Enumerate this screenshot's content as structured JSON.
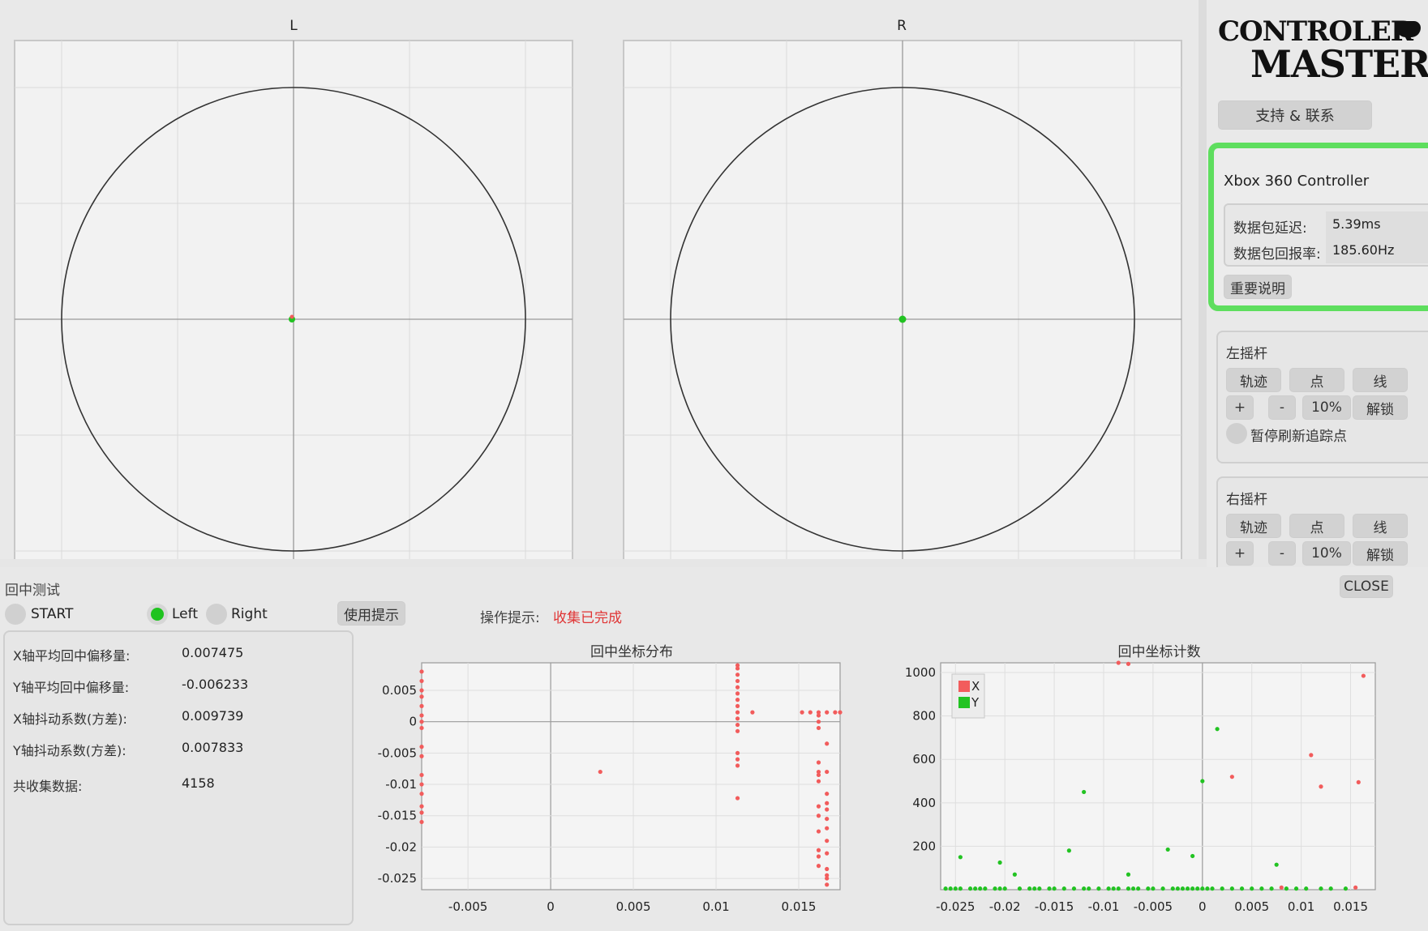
{
  "plots": {
    "left_title": "L",
    "right_title": "R"
  },
  "sidebar": {
    "logo_line1": "CONTROLER",
    "logo_line2": "MASTER",
    "support_label": "支持 & 联系",
    "device_name": "Xbox 360 Controller",
    "latency_label": "数据包延迟:",
    "latency_value": "5.39ms",
    "rate_label": "数据包回报率:",
    "rate_value": "185.60Hz",
    "note_label": "重要说明",
    "left_stick": {
      "title": "左摇杆",
      "trace": "轨迹",
      "point": "点",
      "line": "线",
      "plus": "+",
      "minus": "-",
      "percent": "10%",
      "unlock": "解锁",
      "pause": "暂停刷新追踪点"
    },
    "right_stick": {
      "title": "右摇杆",
      "trace": "轨迹",
      "point": "点",
      "line": "线",
      "plus": "+",
      "minus": "-",
      "percent": "10%",
      "unlock": "解锁"
    }
  },
  "centering": {
    "title": "回中测试",
    "close": "CLOSE",
    "start": "START",
    "left": "Left",
    "right": "Right",
    "selected": "Left",
    "hint_button": "使用提示",
    "op_label": "操作提示:",
    "op_status": "收集已完成",
    "results": [
      {
        "label": "X轴平均回中偏移量:",
        "value": "0.007475"
      },
      {
        "label": "Y轴平均回中偏移量:",
        "value": "-0.006233"
      },
      {
        "label": "X轴抖动系数(方差):",
        "value": "0.009739"
      },
      {
        "label": "Y轴抖动系数(方差):",
        "value": "0.007833"
      },
      {
        "label": "共收集数据:",
        "value": "4158"
      }
    ]
  },
  "colors": {
    "accent_green": "#5ede5e",
    "series_x": "#f25c5c",
    "series_y": "#22c322",
    "status_red": "#e03434"
  },
  "chart_data": [
    {
      "type": "scatter",
      "title": "回中坐标分布",
      "xlim": [
        -0.0078,
        0.0175
      ],
      "ylim": [
        -0.0268,
        0.0094
      ],
      "x_ticks": [
        -0.005,
        0,
        0.005,
        0.01,
        0.015
      ],
      "x_tick_labels": [
        "-0.005",
        "0",
        "0.005",
        "0.01",
        "0.015"
      ],
      "y_ticks": [
        0.005,
        0,
        -0.005,
        -0.01,
        -0.015,
        -0.02,
        -0.025
      ],
      "y_tick_labels": [
        "0.005",
        "0",
        "-0.005",
        "-0.01",
        "-0.015",
        "-0.02",
        "-0.025"
      ],
      "series": [
        {
          "points": [
            [
              -0.0078,
              0.008
            ],
            [
              -0.0078,
              0.0065
            ],
            [
              -0.0078,
              0.005
            ],
            [
              -0.0078,
              0.004
            ],
            [
              -0.0078,
              0.0025
            ],
            [
              -0.0078,
              0.001
            ],
            [
              -0.0078,
              0.0
            ],
            [
              -0.0078,
              -0.001
            ],
            [
              -0.0078,
              -0.004
            ],
            [
              -0.0078,
              -0.0055
            ],
            [
              -0.0078,
              -0.0085
            ],
            [
              -0.0078,
              -0.01
            ],
            [
              -0.0078,
              -0.0115
            ],
            [
              -0.0078,
              -0.0135
            ],
            [
              -0.0078,
              -0.0145
            ],
            [
              -0.0078,
              -0.016
            ],
            [
              0.003,
              -0.008
            ],
            [
              0.0113,
              0.009
            ],
            [
              0.0113,
              0.0085
            ],
            [
              0.0113,
              0.0075
            ],
            [
              0.0113,
              0.0065
            ],
            [
              0.0113,
              0.0055
            ],
            [
              0.0113,
              0.0045
            ],
            [
              0.0113,
              0.0035
            ],
            [
              0.0113,
              0.0025
            ],
            [
              0.0113,
              0.0015
            ],
            [
              0.0113,
              0.0005
            ],
            [
              0.0113,
              -0.0005
            ],
            [
              0.0113,
              -0.0015
            ],
            [
              0.0113,
              -0.005
            ],
            [
              0.0113,
              -0.006
            ],
            [
              0.0113,
              -0.007
            ],
            [
              0.0113,
              -0.0122
            ],
            [
              0.0122,
              0.0015
            ],
            [
              0.0152,
              0.0015
            ],
            [
              0.0157,
              0.0015
            ],
            [
              0.0162,
              0.0015
            ],
            [
              0.0167,
              0.0015
            ],
            [
              0.0172,
              0.0015
            ],
            [
              0.0175,
              0.0015
            ],
            [
              0.0162,
              0.001
            ],
            [
              0.0162,
              0.0
            ],
            [
              0.0162,
              -0.001
            ],
            [
              0.0162,
              -0.0065
            ],
            [
              0.0162,
              -0.008
            ],
            [
              0.0162,
              -0.0085
            ],
            [
              0.0162,
              -0.0095
            ],
            [
              0.0162,
              -0.0135
            ],
            [
              0.0162,
              -0.015
            ],
            [
              0.0162,
              -0.0175
            ],
            [
              0.0162,
              -0.0205
            ],
            [
              0.0162,
              -0.0215
            ],
            [
              0.0162,
              -0.023
            ],
            [
              0.0167,
              -0.008
            ],
            [
              0.0167,
              -0.0115
            ],
            [
              0.0167,
              -0.013
            ],
            [
              0.0167,
              -0.014
            ],
            [
              0.0167,
              -0.0155
            ],
            [
              0.0167,
              -0.017
            ],
            [
              0.0167,
              -0.019
            ],
            [
              0.0167,
              -0.021
            ],
            [
              0.0167,
              -0.0235
            ],
            [
              0.0167,
              -0.0245
            ],
            [
              0.0167,
              -0.025
            ],
            [
              0.0167,
              -0.026
            ],
            [
              0.0167,
              -0.0035
            ]
          ]
        }
      ]
    },
    {
      "type": "scatter",
      "title": "回中坐标计数",
      "xlim": [
        -0.0265,
        0.0175
      ],
      "ylim": [
        0,
        1045
      ],
      "x_ticks": [
        -0.025,
        -0.02,
        -0.015,
        -0.01,
        -0.005,
        0,
        0.005,
        0.01,
        0.015
      ],
      "x_tick_labels": [
        "-0.025",
        "-0.02",
        "-0.015",
        "-0.01",
        "-0.005",
        "0",
        "0.005",
        "0.01",
        "0.015"
      ],
      "y_ticks": [
        200,
        400,
        600,
        800,
        1000
      ],
      "y_tick_labels": [
        "200",
        "400",
        "600",
        "800",
        "1000"
      ],
      "legend": [
        "X",
        "Y"
      ],
      "legend_position": "top-left",
      "series": [
        {
          "name": "X",
          "points": [
            [
              -0.0075,
              1040
            ],
            [
              0.003,
              520
            ],
            [
              0.011,
              620
            ],
            [
              0.012,
              475
            ],
            [
              0.0158,
              495
            ],
            [
              0.0163,
              985
            ],
            [
              -0.0085,
              1045
            ],
            [
              0.008,
              10
            ],
            [
              0.0155,
              10
            ]
          ]
        },
        {
          "name": "Y",
          "points": [
            [
              -0.0245,
              150
            ],
            [
              -0.0205,
              125
            ],
            [
              -0.019,
              70
            ],
            [
              -0.0135,
              180
            ],
            [
              -0.012,
              450
            ],
            [
              -0.0075,
              70
            ],
            [
              -0.0035,
              185
            ],
            [
              -0.001,
              155
            ],
            [
              0.0,
              500
            ],
            [
              0.0015,
              740
            ],
            [
              0.0075,
              115
            ],
            [
              -0.026,
              5
            ],
            [
              -0.0255,
              5
            ],
            [
              -0.025,
              5
            ],
            [
              -0.0245,
              5
            ],
            [
              -0.0235,
              5
            ],
            [
              -0.023,
              5
            ],
            [
              -0.0225,
              5
            ],
            [
              -0.022,
              5
            ],
            [
              -0.021,
              5
            ],
            [
              -0.0205,
              5
            ],
            [
              -0.02,
              5
            ],
            [
              -0.0185,
              5
            ],
            [
              -0.0175,
              5
            ],
            [
              -0.017,
              5
            ],
            [
              -0.0165,
              5
            ],
            [
              -0.0155,
              5
            ],
            [
              -0.015,
              5
            ],
            [
              -0.014,
              5
            ],
            [
              -0.013,
              5
            ],
            [
              -0.012,
              5
            ],
            [
              -0.0115,
              5
            ],
            [
              -0.0105,
              5
            ],
            [
              -0.0095,
              5
            ],
            [
              -0.009,
              5
            ],
            [
              -0.0085,
              5
            ],
            [
              -0.0075,
              5
            ],
            [
              -0.007,
              5
            ],
            [
              -0.0065,
              5
            ],
            [
              -0.0055,
              5
            ],
            [
              -0.005,
              5
            ],
            [
              -0.004,
              5
            ],
            [
              -0.003,
              5
            ],
            [
              -0.0025,
              5
            ],
            [
              -0.002,
              5
            ],
            [
              -0.0015,
              5
            ],
            [
              -0.001,
              5
            ],
            [
              -0.0005,
              5
            ],
            [
              0.0,
              5
            ],
            [
              0.0005,
              5
            ],
            [
              0.001,
              5
            ],
            [
              0.002,
              5
            ],
            [
              0.003,
              5
            ],
            [
              0.004,
              5
            ],
            [
              0.005,
              5
            ],
            [
              0.006,
              5
            ],
            [
              0.007,
              5
            ],
            [
              0.0085,
              5
            ],
            [
              0.0095,
              5
            ],
            [
              0.0105,
              5
            ],
            [
              0.012,
              5
            ],
            [
              0.013,
              5
            ],
            [
              0.0145,
              5
            ]
          ]
        }
      ]
    }
  ]
}
